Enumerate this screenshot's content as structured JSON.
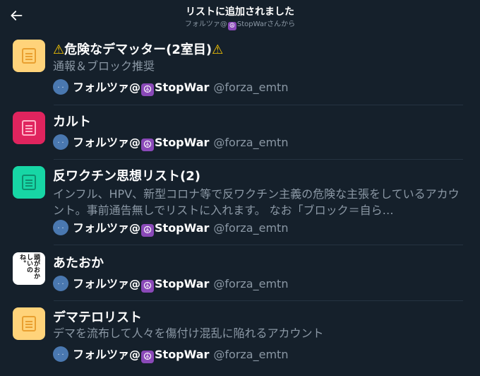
{
  "header": {
    "title": "リストに追加されました",
    "subtitle_prefix": "フォルツァ@",
    "subtitle_peace": "☮",
    "subtitle_suffix": "StopWarさんから",
    "back_icon": "arrow-left-icon"
  },
  "owner": {
    "name_prefix": "フォルツァ@",
    "peace": "☮",
    "name_suffix": "StopWar",
    "handle": "@forza_emtn"
  },
  "colors": {
    "background": "#15202b",
    "yellow_icon": "#ffd37a",
    "pink_icon": "#e0245e",
    "teal_icon": "#17d6a5",
    "secondary_text": "#8b98a5"
  },
  "lists": [
    {
      "warn_left": "⚠",
      "name": "危険なデマッター(2室目)",
      "warn_right": "⚠",
      "description": "通報＆ブロック推奨"
    },
    {
      "name": "カルト",
      "description": ""
    },
    {
      "name": "反ワクチン思想リスト(2)",
      "description": "インフル、HPV、新型コロナ等で反ワクチン主義の危険な主張をしているアカウント。事前通告無しでリストに入れます。 なお「ブロック＝自ら…"
    },
    {
      "name": "あたおか",
      "description": "",
      "image_text": "頭がおかしいのね。"
    },
    {
      "name": "デマテロリスト",
      "description": "デマを流布して人々を傷付け混乱に陥れるアカウント"
    }
  ]
}
